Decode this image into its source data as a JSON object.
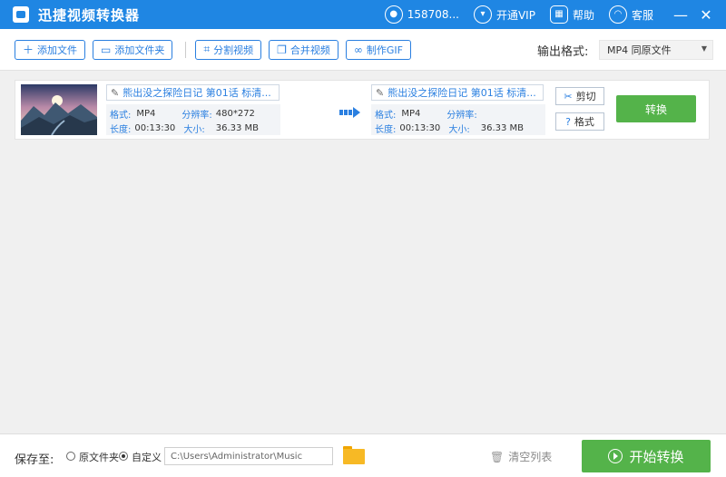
{
  "app": {
    "title": "迅捷视频转换器"
  },
  "titlebar": {
    "user": "158708...",
    "vip": "开通VIP",
    "help": "帮助",
    "service": "客服",
    "minimize": "—",
    "close": "✕"
  },
  "toolbar": {
    "add_file": "添加文件",
    "add_folder": "添加文件夹",
    "split_video": "分割视频",
    "merge_video": "合并视频",
    "make_gif": "制作GIF",
    "output_format_label": "输出格式:",
    "output_format_value": "MP4  同原文件"
  },
  "file": {
    "source": {
      "name": "熊出没之探险日记 第01话 标清...",
      "format_label": "格式:",
      "format": "MP4",
      "resolution_label": "分辨率:",
      "resolution": "480*272",
      "duration_label": "长度:",
      "duration": "00:13:30",
      "size_label": "大小:",
      "size": "36.33 MB"
    },
    "target": {
      "name": "熊出没之探险日记 第01话 标清...",
      "format_label": "格式:",
      "format": "MP4",
      "resolution_label": "分辨率:",
      "resolution": "",
      "duration_label": "长度:",
      "duration": "00:13:30",
      "size_label": "大小:",
      "size": "36.33 MB"
    },
    "cut_label": "剪切",
    "format_button": "格式",
    "convert_label": "转换"
  },
  "bottom": {
    "save_to": "保存至:",
    "option_original": "原文件夹",
    "option_custom": "自定义",
    "path": "C:\\Users\\Administrator\\Music",
    "clear_list": "清空列表",
    "start": "开始转换"
  },
  "colors": {
    "titlebar": "#1f86e3",
    "accent": "#2a7fe0",
    "green": "#54b34a",
    "folder": "#f7b925"
  },
  "icons": {
    "user": "user-icon",
    "vip": "cart-icon",
    "help": "help-icon",
    "service": "headset-icon",
    "cut": "scissors-icon",
    "format": "help-file-icon",
    "clear": "trash-icon",
    "start": "play-circle-icon",
    "folder": "folder-icon"
  }
}
